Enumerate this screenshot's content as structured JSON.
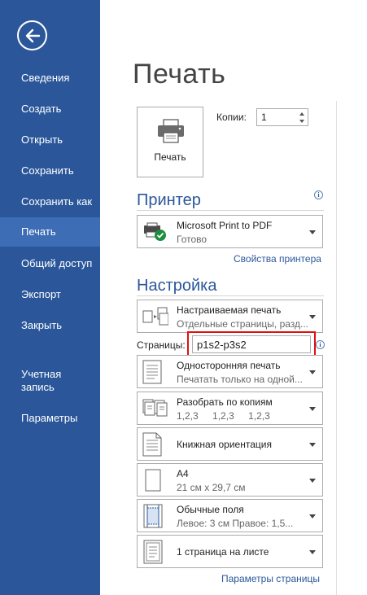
{
  "sidebar": {
    "items": [
      {
        "label": "Сведения"
      },
      {
        "label": "Создать"
      },
      {
        "label": "Открыть"
      },
      {
        "label": "Сохранить"
      },
      {
        "label": "Сохранить как"
      },
      {
        "label": "Печать"
      },
      {
        "label": "Общий доступ"
      },
      {
        "label": "Экспорт"
      },
      {
        "label": "Закрыть"
      },
      {
        "label": "Учетная\nзапись"
      },
      {
        "label": "Параметры"
      }
    ],
    "active": "Печать"
  },
  "main": {
    "title": "Печать",
    "print_button_label": "Печать",
    "copies_label": "Копии:",
    "copies_value": "1",
    "printer": {
      "section_title": "Принтер",
      "name": "Microsoft Print to PDF",
      "status": "Готово",
      "properties_link": "Свойства принтера"
    },
    "settings": {
      "section_title": "Настройка",
      "print_what": {
        "title": "Настраиваемая печать",
        "subtitle": "Отдельные страницы, разд..."
      },
      "pages_label": "Страницы:",
      "pages_value": "p1s2-p3s2",
      "sides": {
        "title": "Односторонняя печать",
        "subtitle": "Печатать только на одной..."
      },
      "collate": {
        "title": "Разобрать по копиям",
        "sequence": [
          "1,2,3",
          "1,2,3",
          "1,2,3"
        ]
      },
      "orientation": {
        "title": "Книжная ориентация"
      },
      "paper": {
        "title": "A4",
        "subtitle": "21 см x 29,7 см"
      },
      "margins": {
        "title": "Обычные поля",
        "subtitle": "Левое:  3 см    Правое:  1,5..."
      },
      "per_sheet": {
        "title": "1 страница на листе"
      },
      "page_setup_link": "Параметры страницы"
    }
  },
  "colors": {
    "sidebar_bg": "#2b579a",
    "sidebar_active": "#3d6db5",
    "accent": "#2b579a",
    "highlight_border": "#e01010"
  }
}
